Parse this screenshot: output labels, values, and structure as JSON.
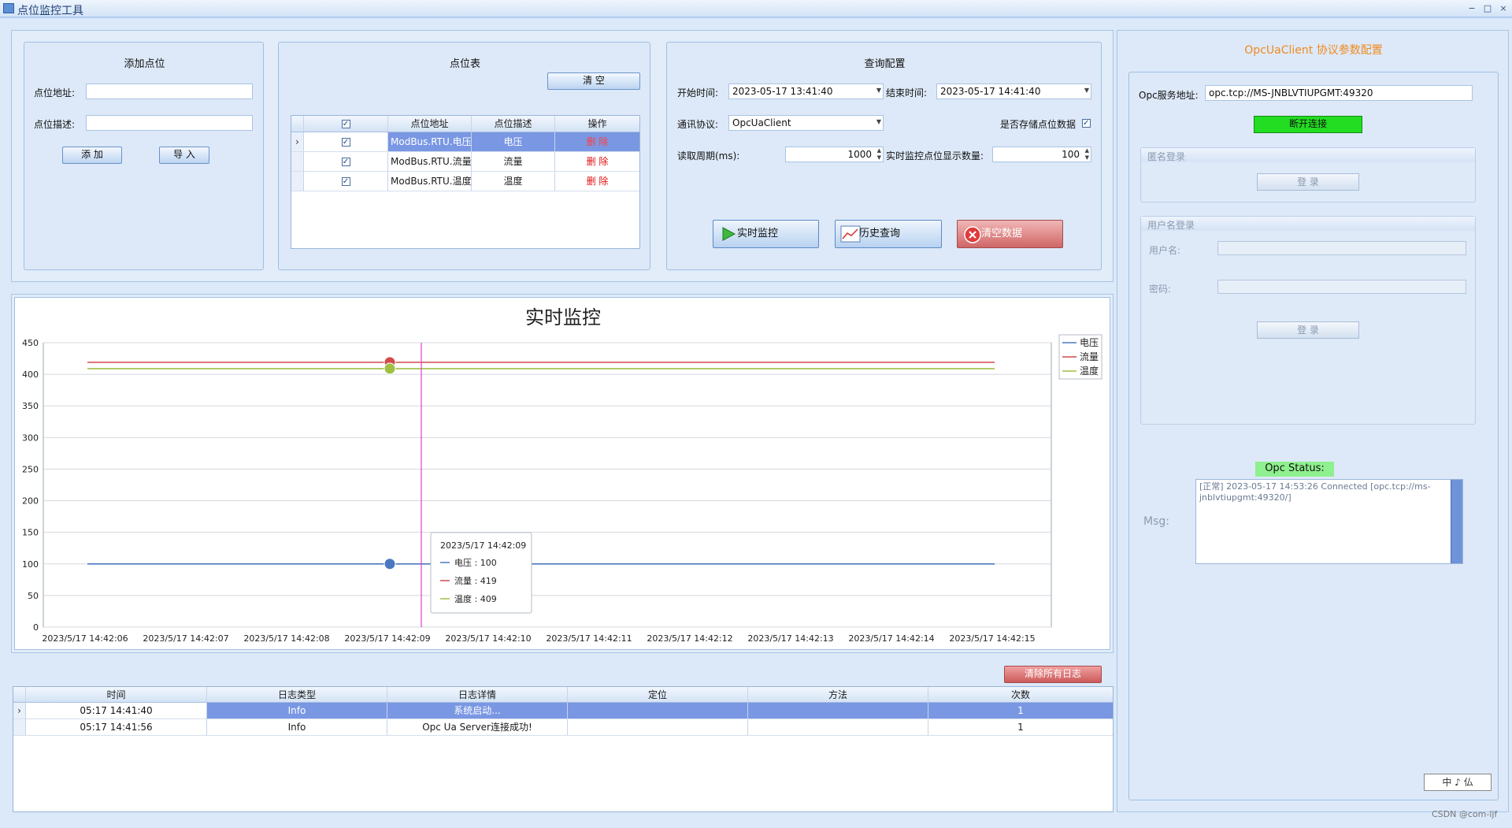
{
  "window": {
    "title": "点位监控工具",
    "controls": [
      "−",
      "□",
      "×"
    ]
  },
  "add_point": {
    "title": "添加点位",
    "address_label": "点位地址:",
    "address_value": "",
    "desc_label": "点位描述:",
    "desc_value": "",
    "add_button": "添 加",
    "import_button": "导 入"
  },
  "point_table": {
    "title": "点位表",
    "clear_button": "清 空",
    "headers": [
      "",
      "☑",
      "点位地址",
      "点位描述",
      "操作"
    ],
    "rows": [
      {
        "selected": true,
        "checked": "✓",
        "address": "ModBus.RTU.电压",
        "desc": "电压",
        "action": "删 除"
      },
      {
        "selected": false,
        "checked": "✓",
        "address": "ModBus.RTU.流量",
        "desc": "流量",
        "action": "删 除"
      },
      {
        "selected": false,
        "checked": "✓",
        "address": "ModBus.RTU.温度",
        "desc": "温度",
        "action": "删 除"
      }
    ]
  },
  "query": {
    "title": "查询配置",
    "start_label": "开始时间:",
    "start_value": "2023-05-17 13:41:40",
    "end_label": "结束时间:",
    "end_value": "2023-05-17 14:41:40",
    "protocol_label": "通讯协议:",
    "protocol_value": "OpcUaClient",
    "store_label": "是否存储点位数据",
    "store_checked": "✓",
    "period_label": "读取周期(ms):",
    "period_value": "1000",
    "count_label": "实时监控点位显示数量:",
    "count_value": "100",
    "realtime_button": "实时监控",
    "history_button": "历史查询",
    "clear_data_button": "清空数据"
  },
  "chart_data": {
    "type": "line",
    "title": "实时监控",
    "x": [
      "2023/5/17 14:42:06",
      "2023/5/17 14:42:07",
      "2023/5/17 14:42:08",
      "2023/5/17 14:42:09",
      "2023/5/17 14:42:10",
      "2023/5/17 14:42:11",
      "2023/5/17 14:42:12",
      "2023/5/17 14:42:13",
      "2023/5/17 14:42:14",
      "2023/5/17 14:42:15"
    ],
    "series": [
      {
        "name": "电压",
        "color": "#4a78c0",
        "values": [
          100,
          100,
          100,
          100,
          100,
          100,
          100,
          100,
          100,
          100
        ]
      },
      {
        "name": "流量",
        "color": "#d24a4a",
        "values": [
          419,
          419,
          419,
          419,
          419,
          419,
          419,
          419,
          419,
          419
        ]
      },
      {
        "name": "温度",
        "color": "#9fbf45",
        "values": [
          409,
          409,
          409,
          409,
          409,
          409,
          409,
          409,
          409,
          409
        ]
      }
    ],
    "ylim": [
      0,
      450
    ],
    "yticks": [
      0,
      50,
      100,
      150,
      200,
      250,
      300,
      350,
      400,
      450
    ],
    "grid": true,
    "legend": "top-right",
    "tooltip": {
      "time": "2023/5/17 14:42:09",
      "entries": [
        "电压 : 100",
        "流量 : 419",
        "温度 : 409"
      ]
    }
  },
  "log": {
    "clear_button": "清除所有日志",
    "headers": [
      "时间",
      "日志类型",
      "日志详情",
      "定位",
      "方法",
      "次数"
    ],
    "rows": [
      {
        "selected": true,
        "time": "05:17 14:41:40",
        "type": "Info",
        "detail": "系统启动...",
        "location": "",
        "method": "",
        "count": "1"
      },
      {
        "selected": false,
        "time": "05:17 14:41:56",
        "type": "Info",
        "detail": "Opc Ua Server连接成功!",
        "location": "",
        "method": "",
        "count": "1"
      }
    ]
  },
  "opc": {
    "title": "OpcUaClient 协议参数配置",
    "server_label": "Opc服务地址:",
    "server_value": "opc.tcp://MS-JNBLVTIUPGMT:49320",
    "disconnect_button": "断开连接",
    "anon_title": "匿名登录",
    "anon_login_button": "登 录",
    "user_title": "用户名登录",
    "username_label": "用户名:",
    "password_label": "密码:",
    "user_login_button": "登 录",
    "status_label": "Opc Status:",
    "msg_label": "Msg:",
    "msg_text": "[正常]  2023-05-17 14:53:26  Connected [opc.tcp://ms-jnblvtiupgmt:49320/]"
  },
  "footer": {
    "ime": "中 ♪ 仏",
    "credit": "CSDN @com-ljf"
  }
}
